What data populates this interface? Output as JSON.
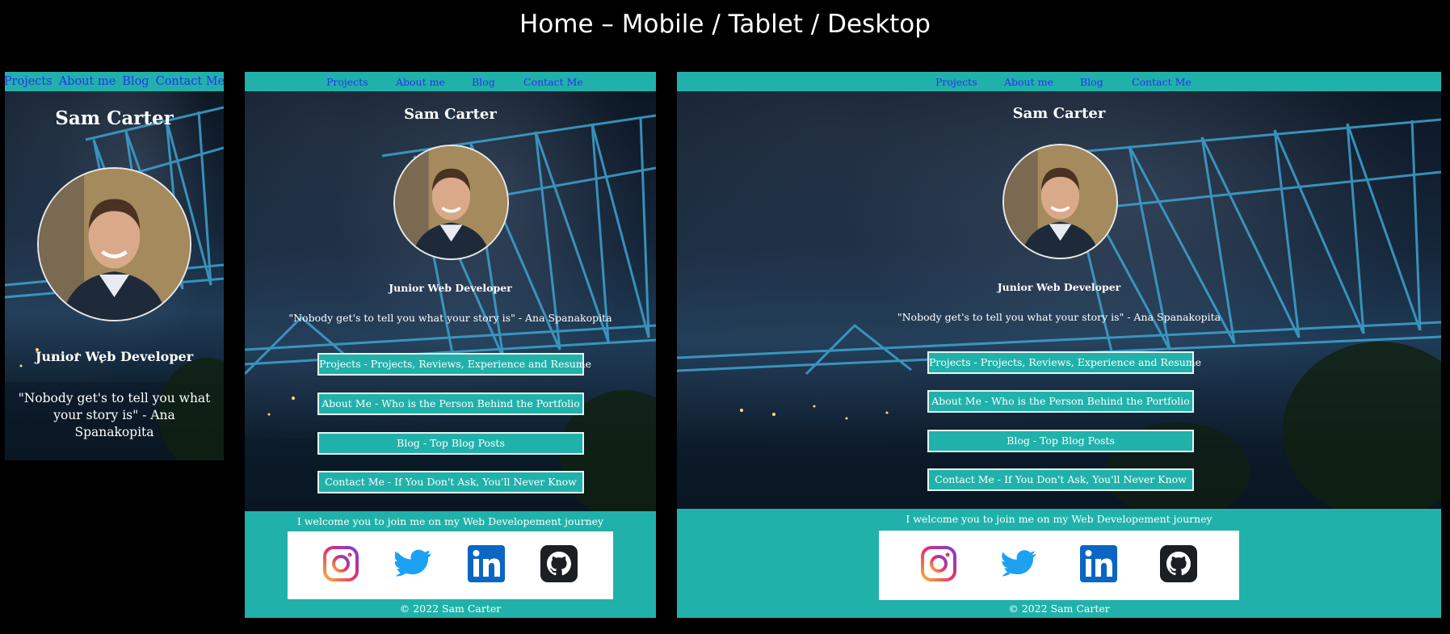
{
  "page_title": "Home – Mobile / Tablet / Desktop",
  "nav": [
    "Projects",
    "About me",
    "Blog",
    "Contact Me"
  ],
  "name": "Sam Carter",
  "role": "Junior Web Developer",
  "quote": "\"Nobody get's to tell you what your story is\" - Ana Spanakopita",
  "buttons": [
    "Projects - Projects, Reviews, Experience and Resume",
    "About Me - Who is the Person Behind the Portfolio",
    "Blog - Top Blog Posts",
    "Contact Me - If You Don't Ask, You'll Never Know"
  ],
  "footer": {
    "welcome": "I welcome you to join me on my Web Developement journey",
    "copyright": "© 2022 Sam Carter"
  },
  "social_icons": [
    "instagram-icon",
    "twitter-icon",
    "linkedin-icon",
    "github-icon"
  ],
  "colors": {
    "teal": "#20b2aa",
    "nav_link": "#2e2ef5",
    "background": "#000000"
  }
}
